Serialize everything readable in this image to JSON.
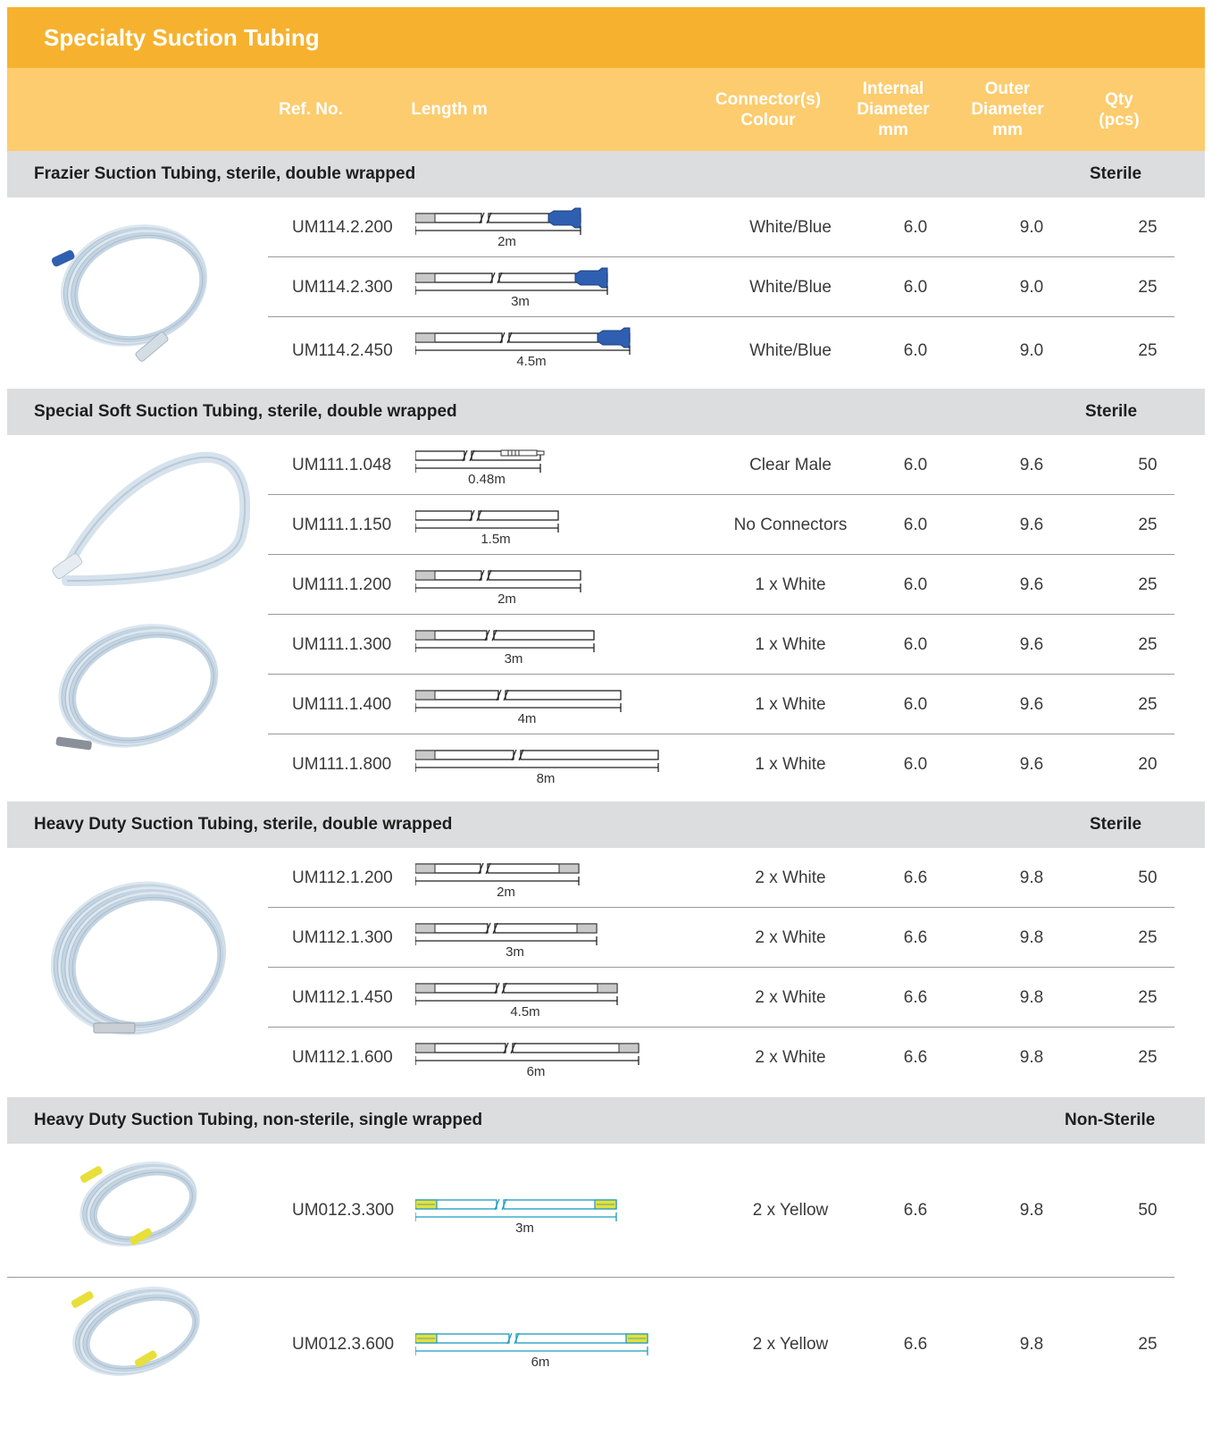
{
  "title": "Specialty Suction Tubing",
  "columns": {
    "ref": "Ref. No.",
    "length": "Length m",
    "connector_l1": "Connector(s)",
    "connector_l2": "Colour",
    "internal_l1": "Internal",
    "internal_l2": "Diameter",
    "internal_l3": "mm",
    "outer_l1": "Outer",
    "outer_l2": "Diameter",
    "outer_l3": "mm",
    "qty_l1": "Qty",
    "qty_l2": "(pcs)"
  },
  "sections": [
    {
      "title": "Frazier Suction Tubing, sterile, double wrapped",
      "status": "Sterile",
      "rows": [
        {
          "ref": "UM114.2.200",
          "length": "2m",
          "connector": "White/Blue",
          "internal": "6.0",
          "outer": "9.0",
          "qty": "25"
        },
        {
          "ref": "UM114.2.300",
          "length": "3m",
          "connector": "White/Blue",
          "internal": "6.0",
          "outer": "9.0",
          "qty": "25"
        },
        {
          "ref": "UM114.2.450",
          "length": "4.5m",
          "connector": "White/Blue",
          "internal": "6.0",
          "outer": "9.0",
          "qty": "25"
        }
      ]
    },
    {
      "title": "Special Soft Suction Tubing, sterile, double wrapped",
      "status": "Sterile",
      "rows": [
        {
          "ref": "UM111.1.048",
          "length": "0.48m",
          "connector": "Clear Male",
          "internal": "6.0",
          "outer": "9.6",
          "qty": "50"
        },
        {
          "ref": "UM111.1.150",
          "length": "1.5m",
          "connector": "No Connectors",
          "internal": "6.0",
          "outer": "9.6",
          "qty": "25"
        },
        {
          "ref": "UM111.1.200",
          "length": "2m",
          "connector": "1 x White",
          "internal": "6.0",
          "outer": "9.6",
          "qty": "25"
        },
        {
          "ref": "UM111.1.300",
          "length": "3m",
          "connector": "1 x White",
          "internal": "6.0",
          "outer": "9.6",
          "qty": "25"
        },
        {
          "ref": "UM111.1.400",
          "length": "4m",
          "connector": "1 x White",
          "internal": "6.0",
          "outer": "9.6",
          "qty": "25"
        },
        {
          "ref": "UM111.1.800",
          "length": "8m",
          "connector": "1 x White",
          "internal": "6.0",
          "outer": "9.6",
          "qty": "20"
        }
      ]
    },
    {
      "title": "Heavy Duty Suction Tubing, sterile, double wrapped",
      "status": "Sterile",
      "rows": [
        {
          "ref": "UM112.1.200",
          "length": "2m",
          "connector": "2 x White",
          "internal": "6.6",
          "outer": "9.8",
          "qty": "50"
        },
        {
          "ref": "UM112.1.300",
          "length": "3m",
          "connector": "2 x White",
          "internal": "6.6",
          "outer": "9.8",
          "qty": "25"
        },
        {
          "ref": "UM112.1.450",
          "length": "4.5m",
          "connector": "2 x White",
          "internal": "6.6",
          "outer": "9.8",
          "qty": "25"
        },
        {
          "ref": "UM112.1.600",
          "length": "6m",
          "connector": "2 x White",
          "internal": "6.6",
          "outer": "9.8",
          "qty": "25"
        }
      ]
    },
    {
      "title": "Heavy Duty Suction Tubing, non-sterile, single wrapped",
      "status": "Non-Sterile",
      "rows": [
        {
          "ref": "UM012.3.300",
          "length": "3m",
          "connector": "2 x Yellow",
          "internal": "6.6",
          "outer": "9.8",
          "qty": "50"
        },
        {
          "ref": "UM012.3.600",
          "length": "6m",
          "connector": "2 x Yellow",
          "internal": "6.6",
          "outer": "9.8",
          "qty": "25"
        }
      ]
    }
  ],
  "colors": {
    "title_bar": "#f6b22f",
    "header_row": "#fccc6e",
    "section_bg": "#dcdddf",
    "connector_blue": "#2f5fb0",
    "connector_yellow": "#e8df3a",
    "tube_cyan": "#1a9ac0"
  }
}
